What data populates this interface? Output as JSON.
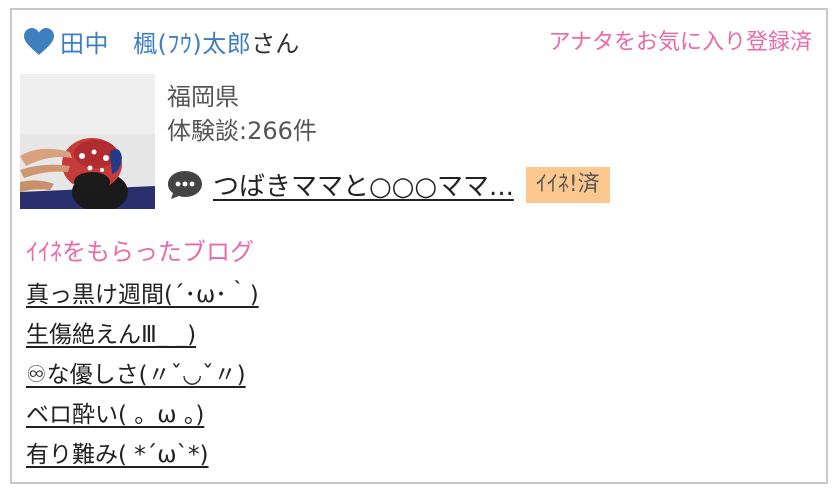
{
  "header": {
    "surname": "田中",
    "given_name": "楓(ﾌｳ)太郎",
    "honorific": "さん",
    "favorite_status": "アナタをお気に入り登録済",
    "heart_icon": "heart-icon",
    "heart_color": "#3f7fbf"
  },
  "profile": {
    "prefecture": "福岡県",
    "experience_count": "体験談:266件",
    "avatar_icon": "profile-photo"
  },
  "latest_post": {
    "comment_icon": "speech-bubble-icon",
    "title": "つばきママと○○○ママ...",
    "badge": "ｲｲﾈ!済",
    "badge_color": "#fcc88f"
  },
  "liked_blogs": {
    "heading": "ｲｲﾈをもらったブログ",
    "heading_color": "#ea6aa8",
    "items": [
      "真っ黒け週間(´･ω･｀)",
      "生傷絶えんⅢ_ _)",
      "♾な優しさ(〃ˇ◡ˇ〃)",
      "ベロ酔い( 。ω 。)",
      "有り難み( *´ω`*)"
    ]
  }
}
